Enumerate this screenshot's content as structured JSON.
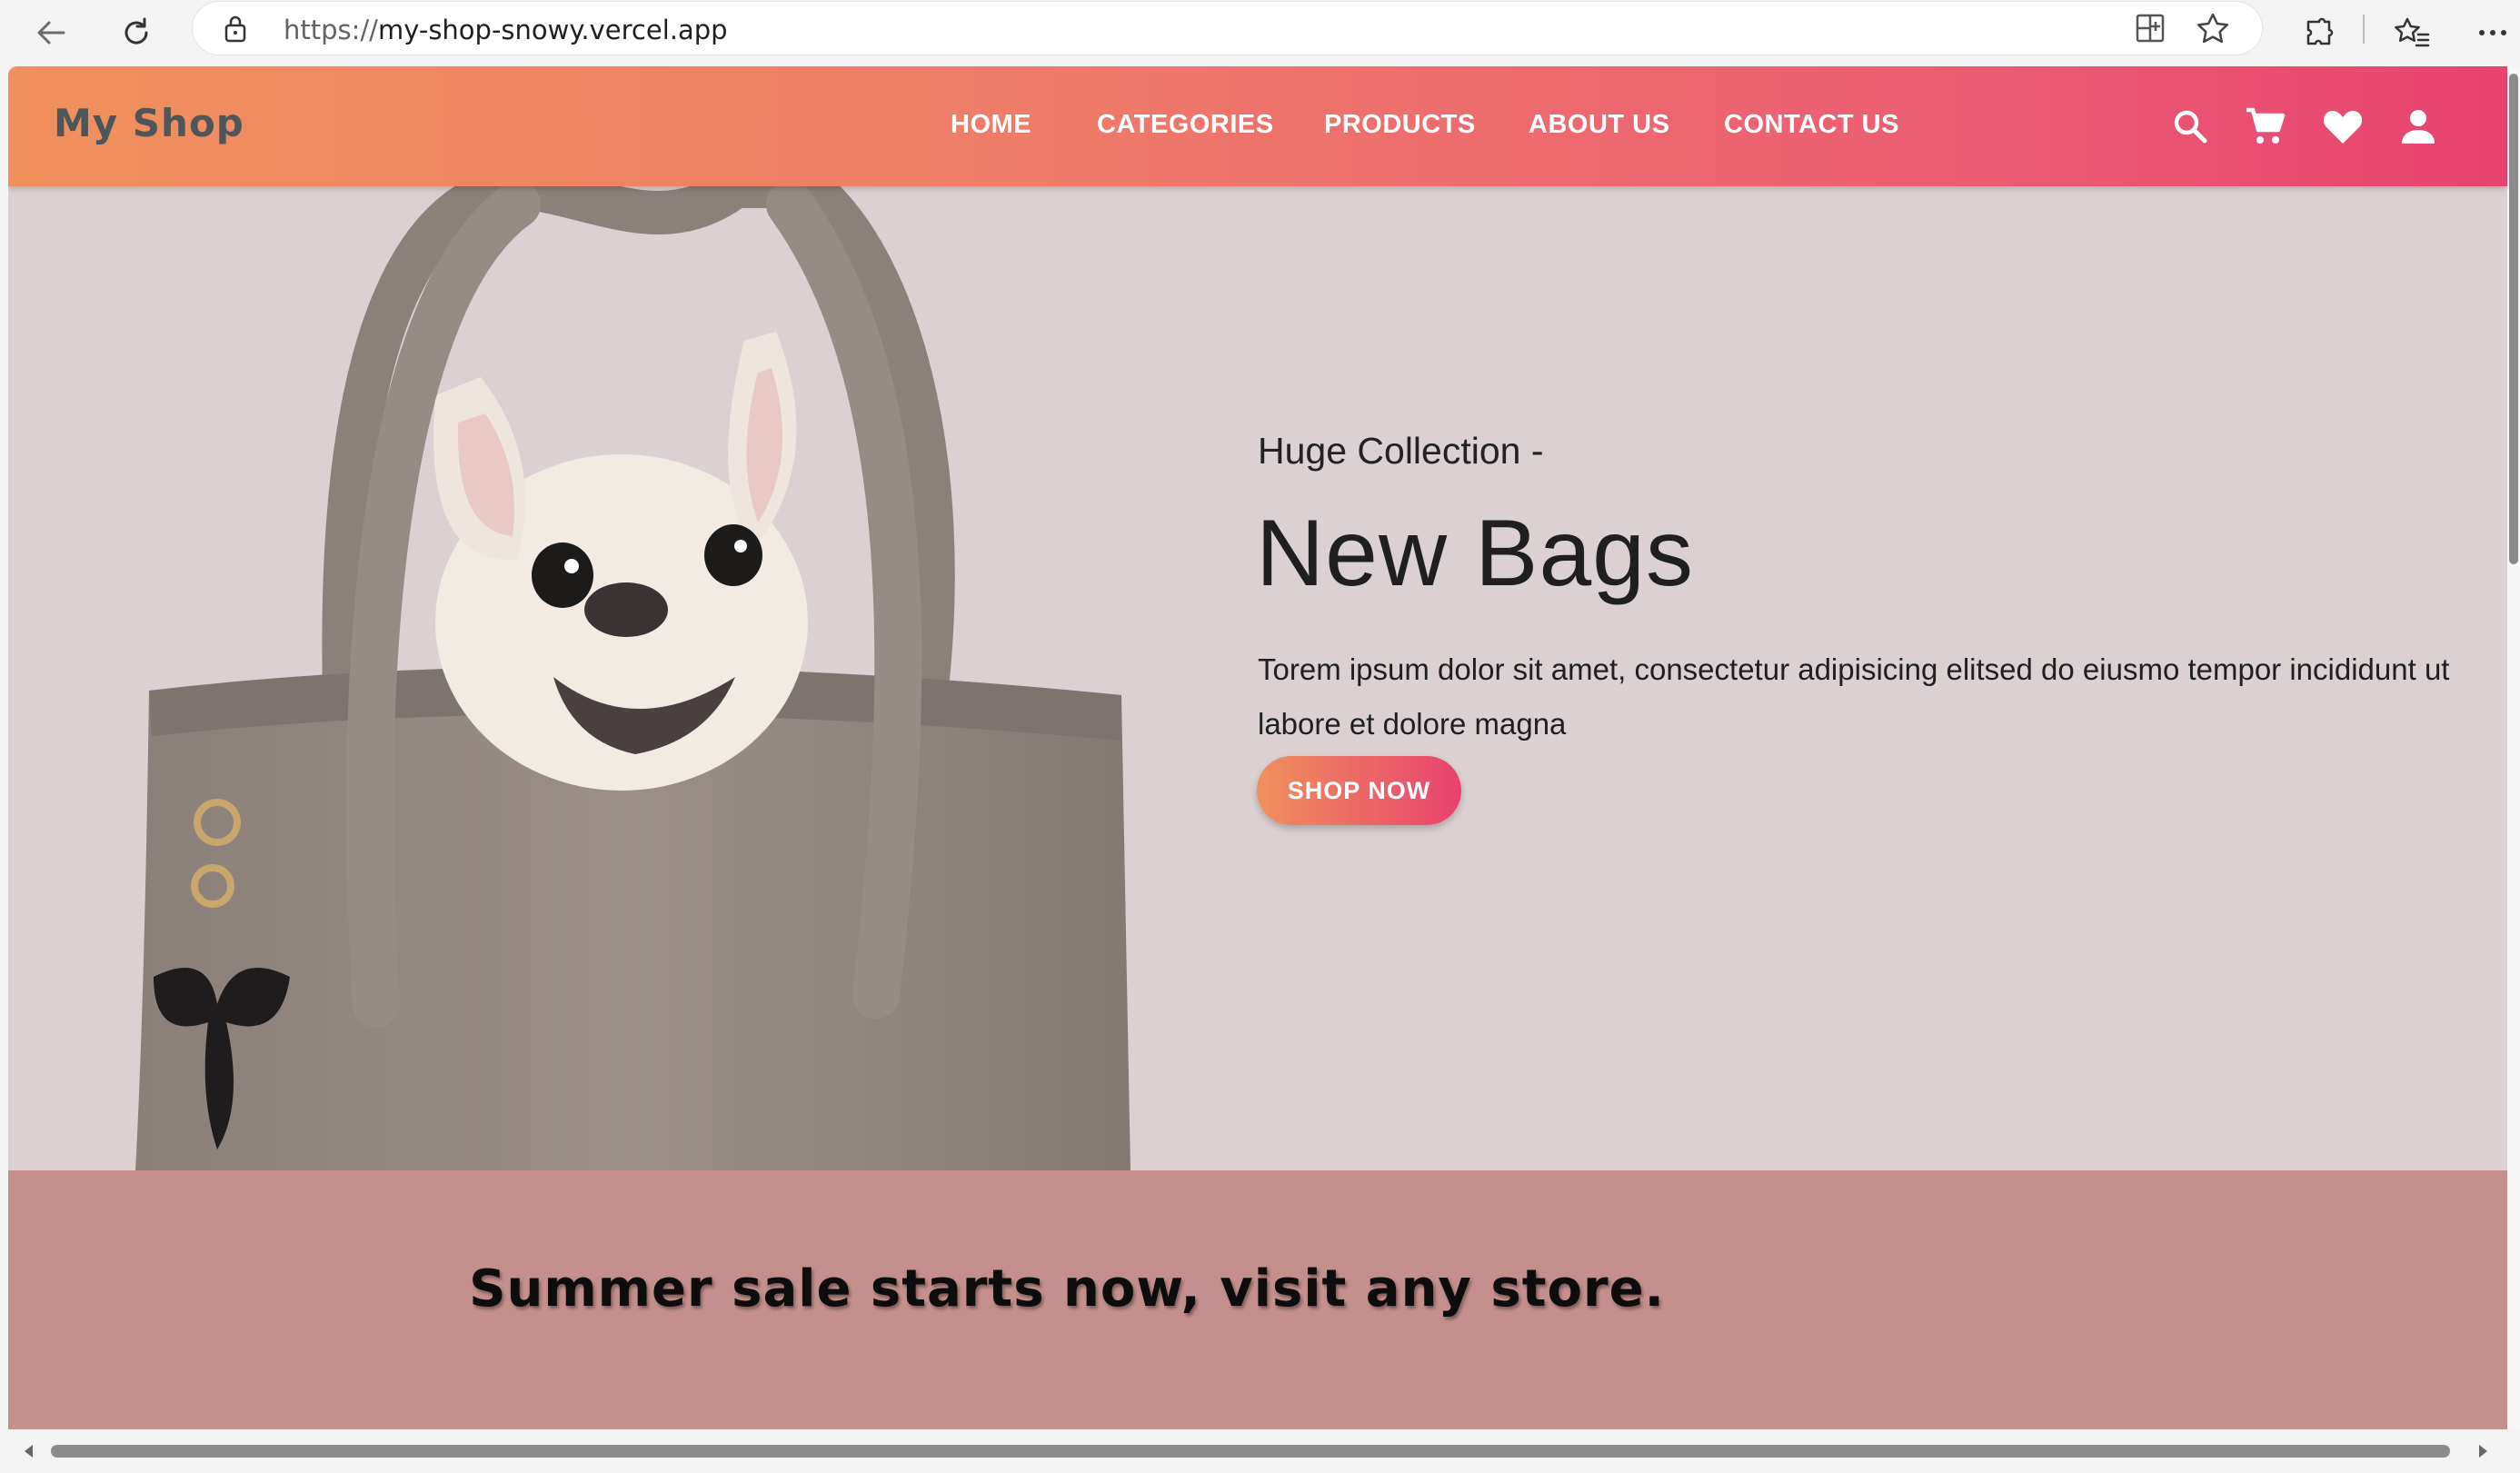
{
  "browser": {
    "url_protocol": "https://",
    "url_host": "my-shop-snowy.vercel.app",
    "icons": [
      "back-arrow-icon",
      "refresh-icon",
      "lock-icon",
      "split-screen-icon",
      "star-icon",
      "extensions-icon",
      "favorites-icon",
      "more-icon"
    ]
  },
  "nav": {
    "logo": "My Shop",
    "links": [
      "HOME",
      "CATEGORIES",
      "PRODUCTS",
      "ABOUT US",
      "CONTACT US"
    ],
    "icons": [
      "search-icon",
      "cart-icon",
      "heart-icon",
      "user-icon"
    ]
  },
  "hero": {
    "subtitle": "Huge Collection -",
    "title": "New Bags",
    "description": "Torem ipsum dolor sit amet, consectetur adipisicing elitsed do eiusmo tempor incididunt ut labore et dolore magna",
    "button": "SHOP NOW"
  },
  "banner": {
    "text": "Summer sale starts now, visit any store."
  },
  "colors": {
    "nav_gradient_start": "#f0905d",
    "nav_gradient_end": "#e8426f",
    "hero_bg": "#dcd1d2",
    "banner_bg": "#c48f8d",
    "logo": "#4c565b"
  }
}
